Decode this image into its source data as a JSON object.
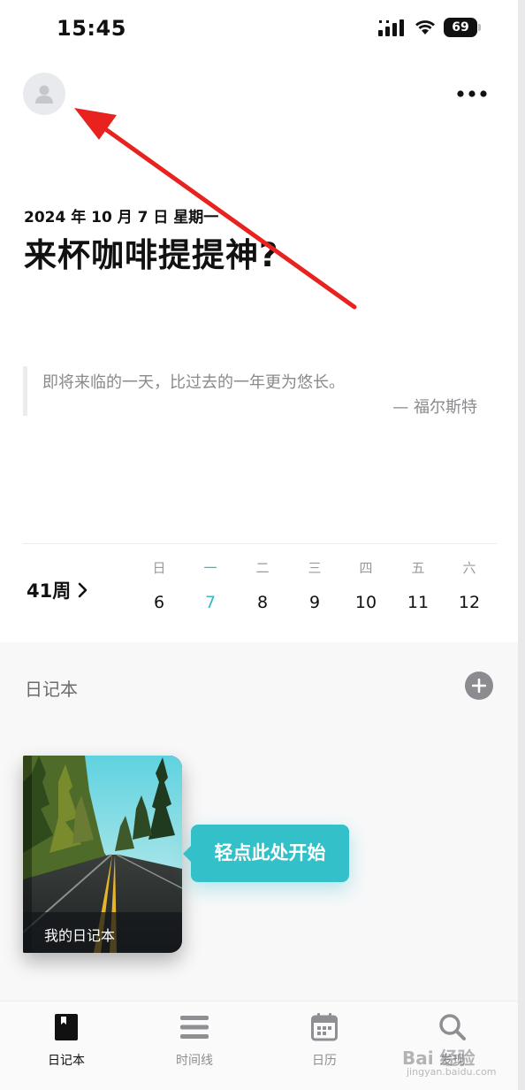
{
  "status_bar": {
    "time": "15:45",
    "battery": "69"
  },
  "header": {
    "avatar_icon": "person-icon",
    "more_icon": "more-dots-icon"
  },
  "today": {
    "date": "2024 年 10 月 7 日 星期一",
    "headline": "来杯咖啡提提神?"
  },
  "quote": {
    "text": "即将来临的一天，比过去的一年更为悠长。",
    "author": "— 福尔斯特"
  },
  "week": {
    "label": "41周",
    "days": [
      {
        "name": "日",
        "num": "6"
      },
      {
        "name": "一",
        "num": "7",
        "today": true
      },
      {
        "name": "二",
        "num": "8"
      },
      {
        "name": "三",
        "num": "9"
      },
      {
        "name": "四",
        "num": "10"
      },
      {
        "name": "五",
        "num": "11"
      },
      {
        "name": "六",
        "num": "12"
      }
    ]
  },
  "notebooks": {
    "title": "日记本",
    "add_icon": "plus-icon",
    "items": [
      {
        "label": "我的日记本"
      }
    ],
    "tooltip": "轻点此处开始"
  },
  "tab_bar": {
    "tabs": [
      {
        "label": "日记本",
        "icon": "notebook-icon",
        "active": true
      },
      {
        "label": "时间线",
        "icon": "list-icon"
      },
      {
        "label": "日历",
        "icon": "calendar-icon"
      },
      {
        "label": "发现",
        "icon": "search-icon"
      }
    ]
  },
  "watermark": {
    "text": "Bai 经验",
    "sub": "jingyan.baidu.com"
  },
  "colors": {
    "accent": "#33c0c8",
    "today": "#3cb8c4",
    "arrow": "#e8231f"
  }
}
